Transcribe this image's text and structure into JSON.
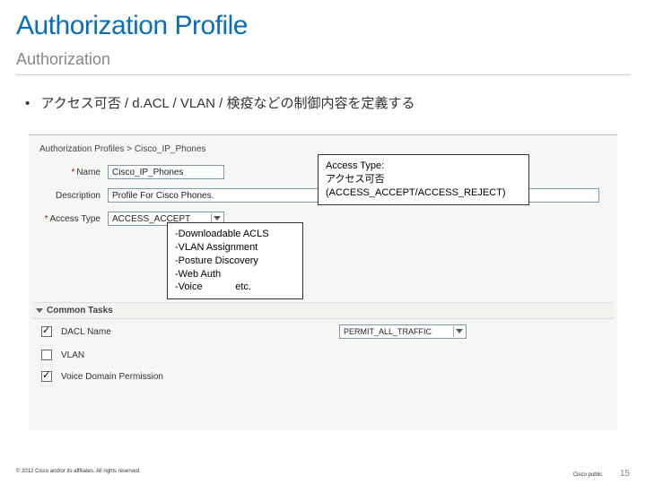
{
  "title": "Authorization Profile",
  "subtitle": "Authorization",
  "bullet": "アクセス可否 / d.ACL / VLAN / 検疫などの制御内容を定義する",
  "ui": {
    "breadcrumb": "Authorization Profiles > Cisco_IP_Phones",
    "name_label": "Name",
    "name_value": "Cisco_IP_Phones",
    "desc_label": "Description",
    "desc_value": "Profile For Cisco Phones.",
    "access_label": "Access Type",
    "access_value": "ACCESS_ACCEPT",
    "common_tasks_header": "Common Tasks",
    "tasks": {
      "dacl_label": "DACL Name",
      "dacl_value": "PERMIT_ALL_TRAFFIC",
      "vlan_label": "VLAN",
      "voice_label": "Voice Domain Permission"
    }
  },
  "callouts": {
    "access": "Access Type:\nアクセス可否\n(ACCESS_ACCEPT/ACCESS_REJECT)",
    "tasks": "-Downloadable ACLS\n-VLAN Assignment\n-Posture Discovery\n-Web Auth\n-Voice            etc."
  },
  "footer": {
    "left": "© 2012 Cisco and/or its affiliates. All rights reserved.",
    "right": "Cisco public",
    "page": "15"
  }
}
